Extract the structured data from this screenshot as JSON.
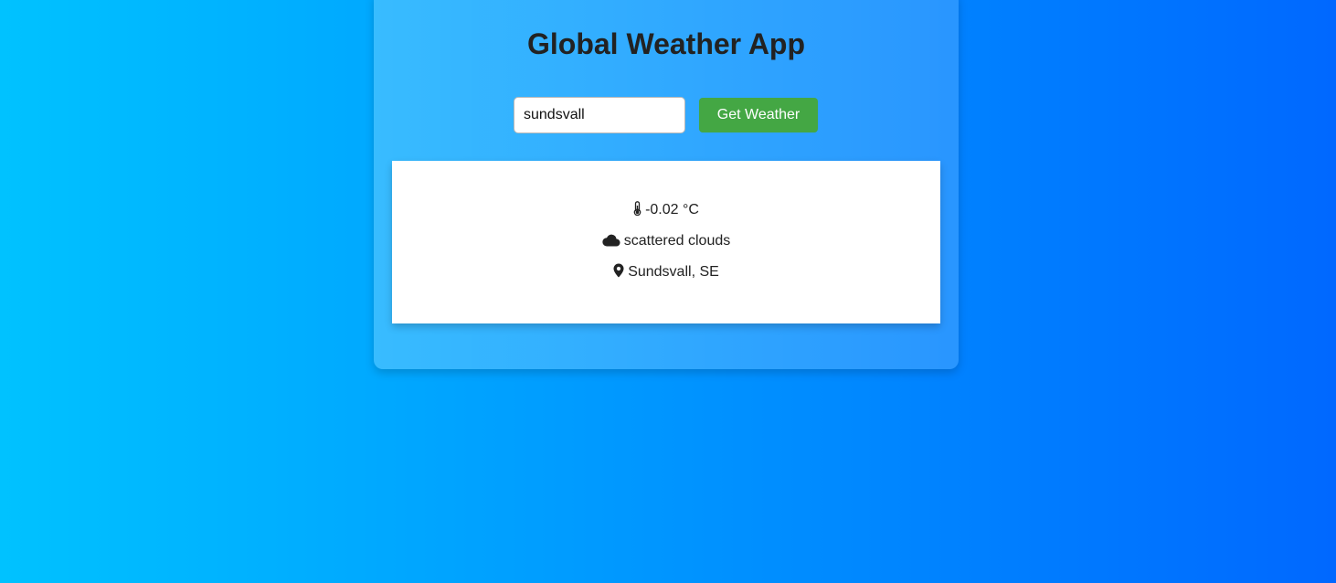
{
  "app": {
    "title": "Global Weather App"
  },
  "search": {
    "value": "sundsvall",
    "button_label": "Get Weather"
  },
  "result": {
    "temperature": "-0.02 °C",
    "temperature_icon": "thermometer-icon",
    "description": "scattered clouds",
    "description_icon": "cloud-icon",
    "location": "Sundsvall, SE",
    "location_icon": "map-pin-icon"
  },
  "colors": {
    "background_start": "#00c2ff",
    "background_end": "#0068ff",
    "button": "#44a744",
    "text": "#222222"
  }
}
